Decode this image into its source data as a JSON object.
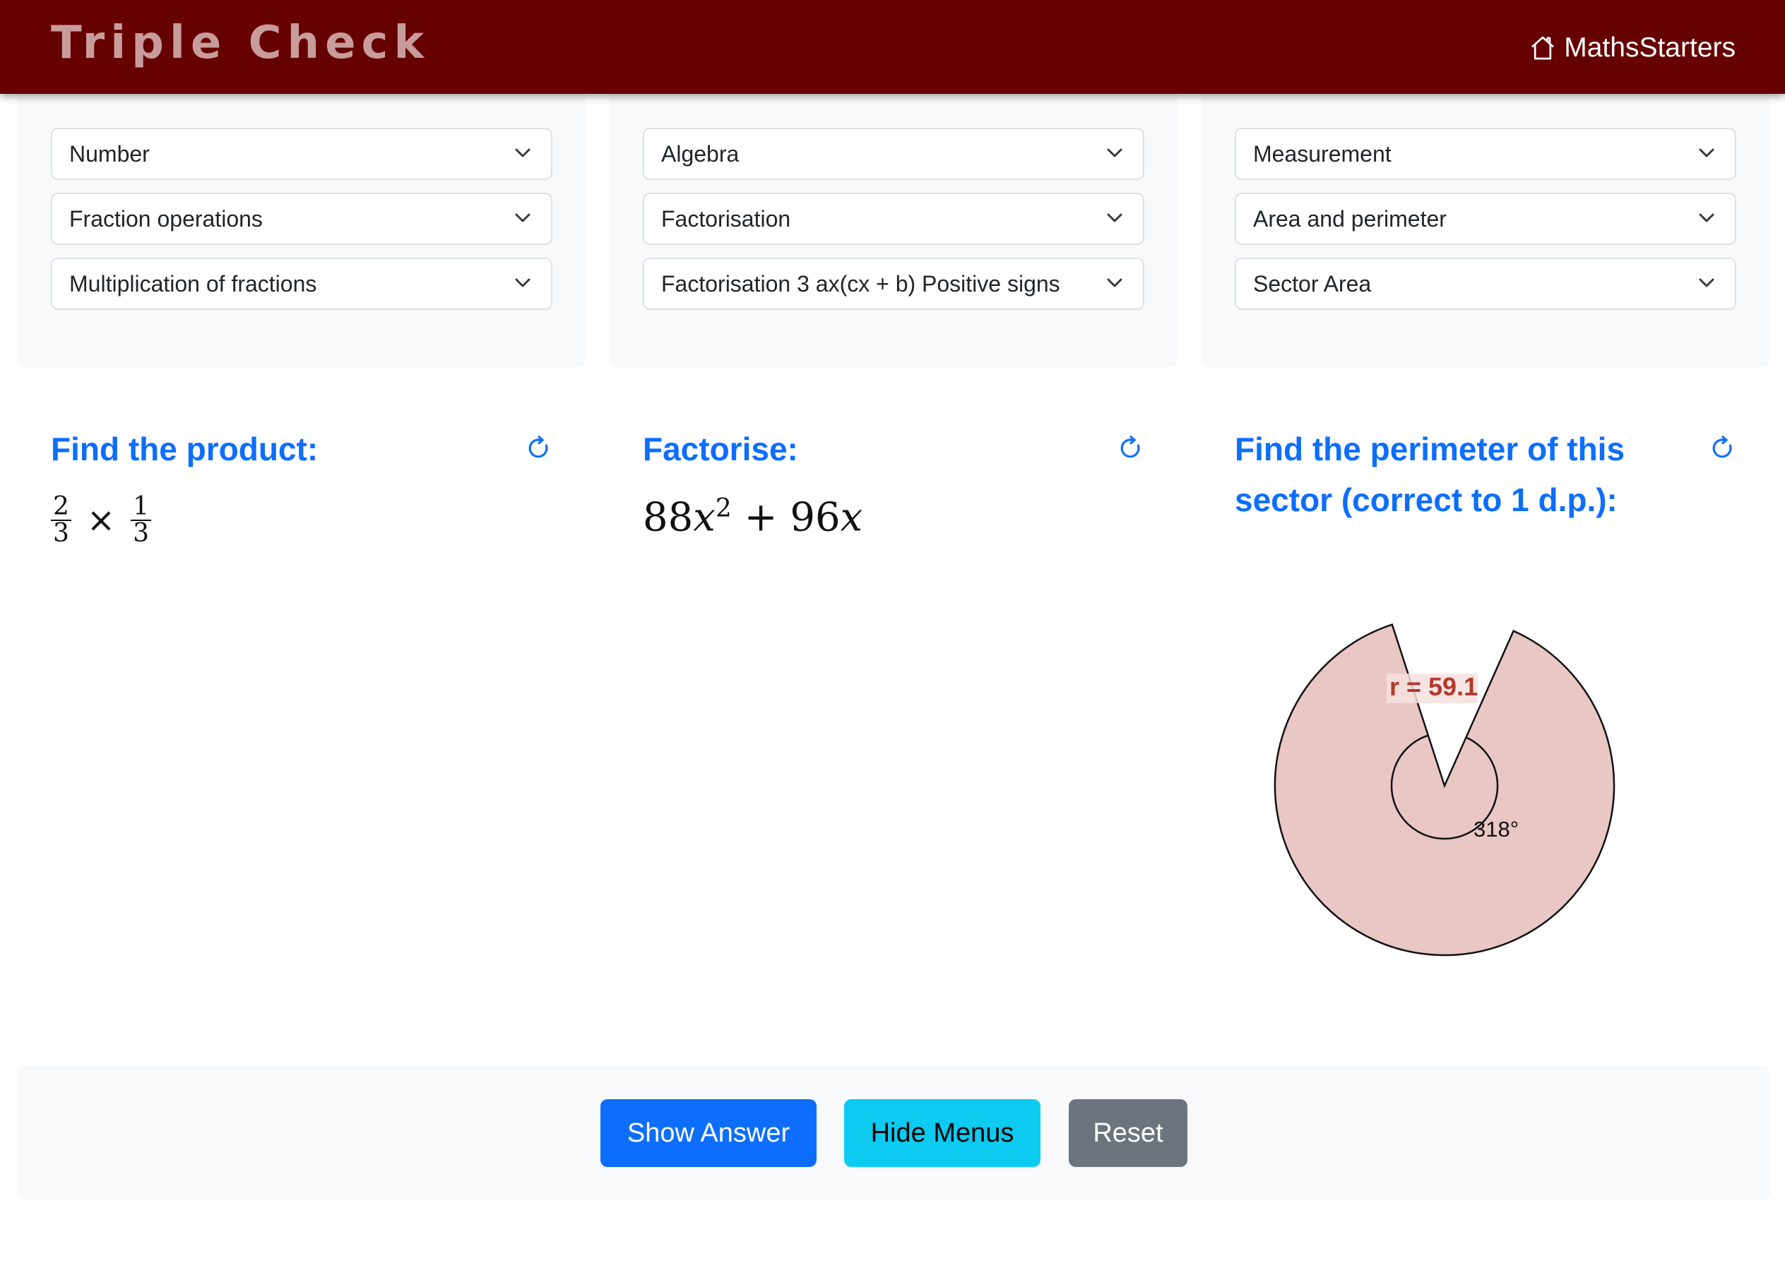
{
  "header": {
    "title": "Triple Check",
    "home_link": "MathsStarters",
    "bg_color": "#660000"
  },
  "columns": [
    {
      "selects": [
        "Number",
        "Fraction operations",
        "Multiplication of fractions"
      ],
      "question": {
        "title": "Find the product:",
        "expr": {
          "a_num": "2",
          "a_den": "3",
          "op": "×",
          "b_num": "1",
          "b_den": "3"
        }
      }
    },
    {
      "selects": [
        "Algebra",
        "Factorisation",
        "Factorisation 3 ax(cx + b) Positive signs"
      ],
      "question": {
        "title": "Factorise:",
        "expr": {
          "coef1": "88",
          "var1": "x",
          "exp1": "2",
          "op": "+",
          "coef2": "96",
          "var2": "x"
        }
      }
    },
    {
      "selects": [
        "Measurement",
        "Area and perimeter",
        "Sector Area"
      ],
      "question": {
        "title": "Find the perimeter of this sector (correct to 1 d.p.):",
        "sector": {
          "radius_label": "r = 59.1",
          "angle_label": "318°",
          "angle_degrees": 318,
          "fill_color": "#e8c7c4",
          "label_color": "#b03a2e"
        }
      }
    }
  ],
  "footer": {
    "show_answer": "Show Answer",
    "hide_menus": "Hide Menus",
    "reset": "Reset"
  },
  "icons": {
    "refresh": "refresh-icon",
    "home": "home-icon",
    "chevron": "chevron-down-icon"
  }
}
